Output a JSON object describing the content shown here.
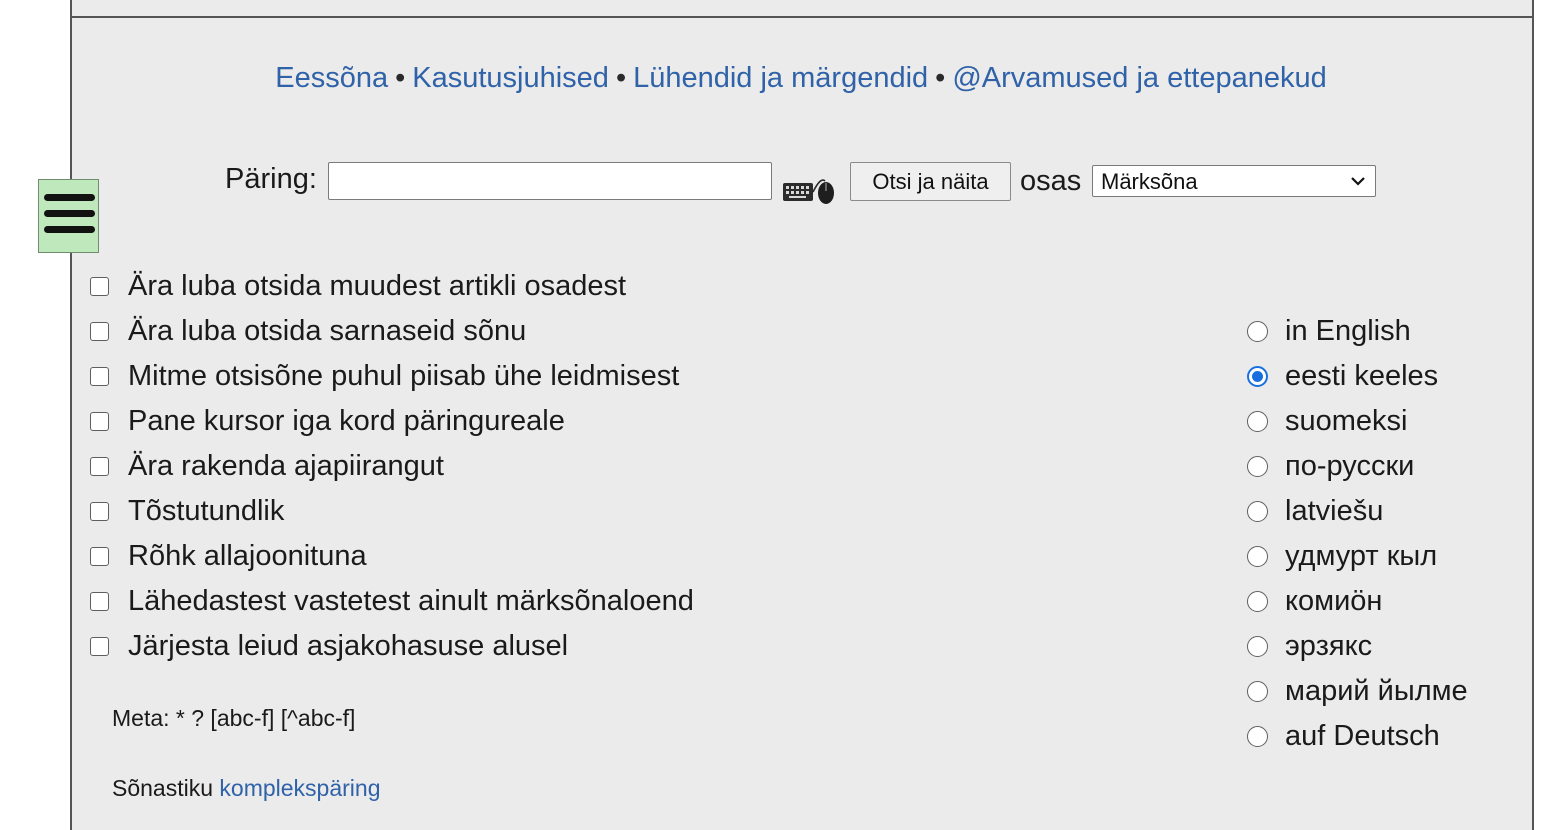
{
  "nav": {
    "links": [
      "Eessõna",
      "Kasutusjuhised",
      "Lühendid ja märgendid",
      "@Arvamused ja ettepanekud"
    ],
    "separator": "•"
  },
  "search": {
    "label": "Päring:",
    "value": "",
    "button_label": "Otsi ja näita",
    "scope_label": "osas",
    "scope_selected": "Märksõna"
  },
  "options": [
    "Ära luba otsida muudest artikli osadest",
    "Ära luba otsida sarnaseid sõnu",
    "Mitme otsisõne puhul piisab ühe leidmisest",
    "Pane kursor iga kord päringureale",
    "Ära rakenda ajapiirangut",
    "Tõstutundlik",
    "Rõhk allajoonituna",
    "Lähedastest vastetest ainult märksõnaloend",
    "Järjesta leiud asjakohasuse alusel"
  ],
  "languages": [
    {
      "label": "in English",
      "checked": false
    },
    {
      "label": "eesti keeles",
      "checked": true
    },
    {
      "label": "suomeksi",
      "checked": false
    },
    {
      "label": "по-русски",
      "checked": false
    },
    {
      "label": "latviešu",
      "checked": false
    },
    {
      "label": "удмурт кыл",
      "checked": false
    },
    {
      "label": "комиӧн",
      "checked": false
    },
    {
      "label": "эрзякс",
      "checked": false
    },
    {
      "label": "марий йылме",
      "checked": false
    },
    {
      "label": "auf Deutsch",
      "checked": false
    }
  ],
  "meta": "Meta: * ? [abc-f] [^abc-f]",
  "complex_search": {
    "prefix": "Sõnastiku",
    "link": "komplekspäring"
  },
  "colors": {
    "link": "#2f62a8",
    "panel_bg": "#ebebeb",
    "menu_button_bg": "#bfe8bd",
    "radio_accent": "#1a6fe0"
  },
  "icons": {
    "menu": "hamburger-icon",
    "keyboard": "keyboard-mouse-icon",
    "dropdown": "chevron-down-icon"
  }
}
